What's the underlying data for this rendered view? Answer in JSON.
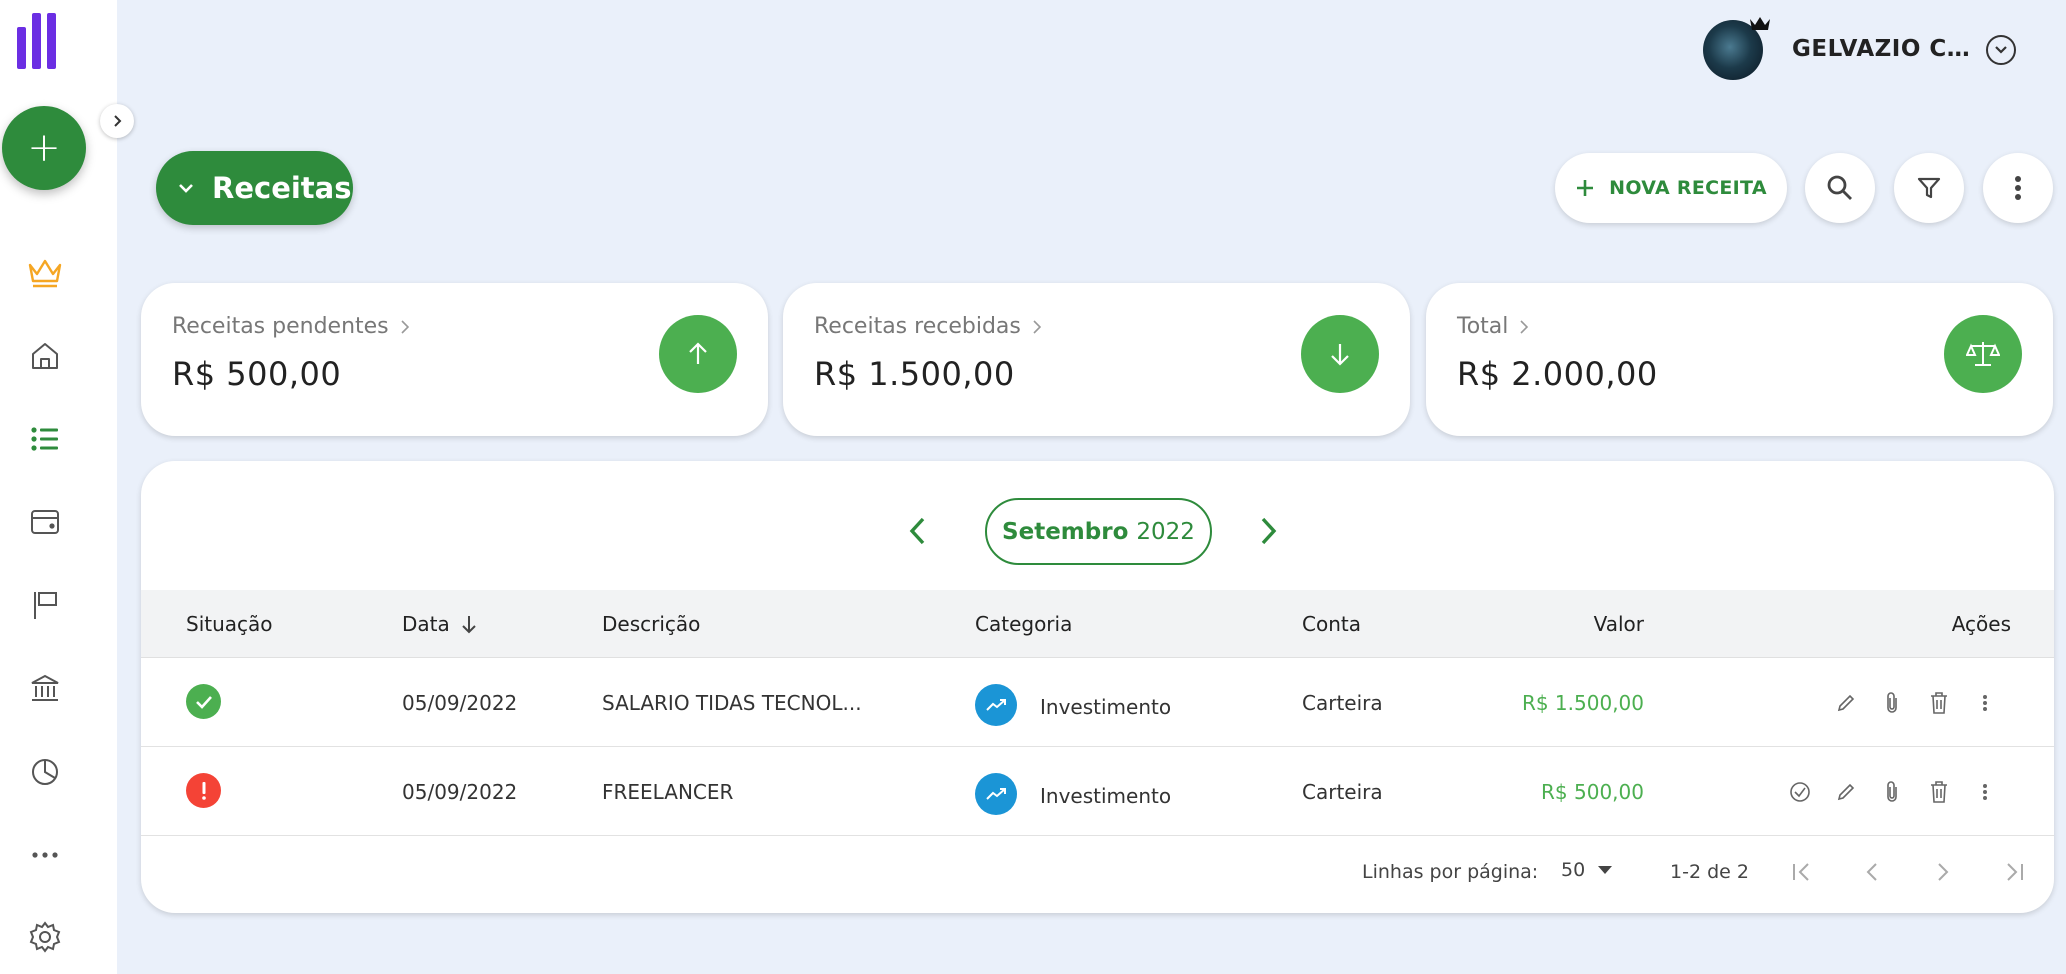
{
  "colors": {
    "primary": "#2e8b3c",
    "accent_green": "#4caf50",
    "brand_purple": "#6b2ee3",
    "category_blue": "#1b95d6",
    "danger": "#f44336",
    "background": "#eaf0fa"
  },
  "sidebar": {
    "logo_icon": "bars-logo-icon",
    "add_icon": "plus-icon",
    "collapse_icon": "chevron-right-icon",
    "nav_icons": [
      "crown-icon",
      "home-icon",
      "list-icon",
      "wallet-icon",
      "flag-icon",
      "bank-icon",
      "pie-chart-icon",
      "more-horizontal-icon",
      "settings-icon"
    ]
  },
  "user": {
    "name": "GELVAZIO CA...",
    "avatar_icon": "user-avatar",
    "badge_icon": "crown-icon",
    "menu_icon": "chevron-down-icon"
  },
  "toolbar": {
    "type_selector_label": "Receitas",
    "new_button_label": "NOVA RECEITA",
    "search_icon": "search-icon",
    "filter_icon": "filter-icon",
    "more_icon": "more-vertical-icon"
  },
  "summary": [
    {
      "label": "Receitas pendentes",
      "value": "R$ 500,00",
      "icon": "arrow-up-icon"
    },
    {
      "label": "Receitas recebidas",
      "value": "R$ 1.500,00",
      "icon": "arrow-down-icon"
    },
    {
      "label": "Total",
      "value": "R$ 2.000,00",
      "icon": "balance-scale-icon"
    }
  ],
  "period": {
    "month": "Setembro",
    "year": "2022"
  },
  "table": {
    "columns": {
      "status": "Situação",
      "date": "Data",
      "description": "Descrição",
      "category": "Categoria",
      "account": "Conta",
      "value": "Valor",
      "actions": "Ações"
    },
    "rows": [
      {
        "status": "received",
        "date": "05/09/2022",
        "description": "SALARIO TIDAS TECNOL...",
        "category": "Investimento",
        "account": "Carteira",
        "value": "R$ 1.500,00"
      },
      {
        "status": "pending",
        "date": "05/09/2022",
        "description": "FREELANCER",
        "category": "Investimento",
        "account": "Carteira",
        "value": "R$ 500,00"
      }
    ]
  },
  "pagination": {
    "rows_per_page_label": "Linhas por página:",
    "rows_per_page": "50",
    "range": "1-2 de 2"
  }
}
